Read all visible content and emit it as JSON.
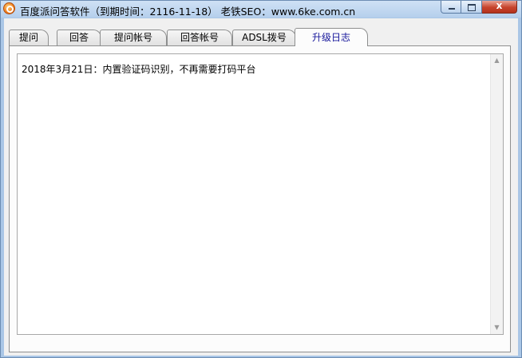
{
  "window": {
    "title": "百度派问答软件（到期时间：2116-11-18）  老铁SEO：www.6ke.com.cn",
    "close_glyph": "x",
    "controls": [
      "minimize",
      "maximize",
      "close"
    ]
  },
  "tabs": [
    {
      "label": "提问",
      "active": false
    },
    {
      "label": "回答",
      "active": false
    },
    {
      "label": "提问帐号",
      "active": false
    },
    {
      "label": "回答帐号",
      "active": false
    },
    {
      "label": "ADSL拨号",
      "active": false
    },
    {
      "label": "升级日志",
      "active": true
    }
  ],
  "log": {
    "text": "2018年3月21日：内置验证码识别，不再需要打码平台"
  },
  "icons": {
    "app": "app-logo-icon",
    "scroll_up": "arrow-up-icon",
    "scroll_down": "arrow-down-icon"
  },
  "colors": {
    "active_tab_text": "#17179b",
    "titlebar": "#b5cfec",
    "close_button": "#c7432c"
  }
}
